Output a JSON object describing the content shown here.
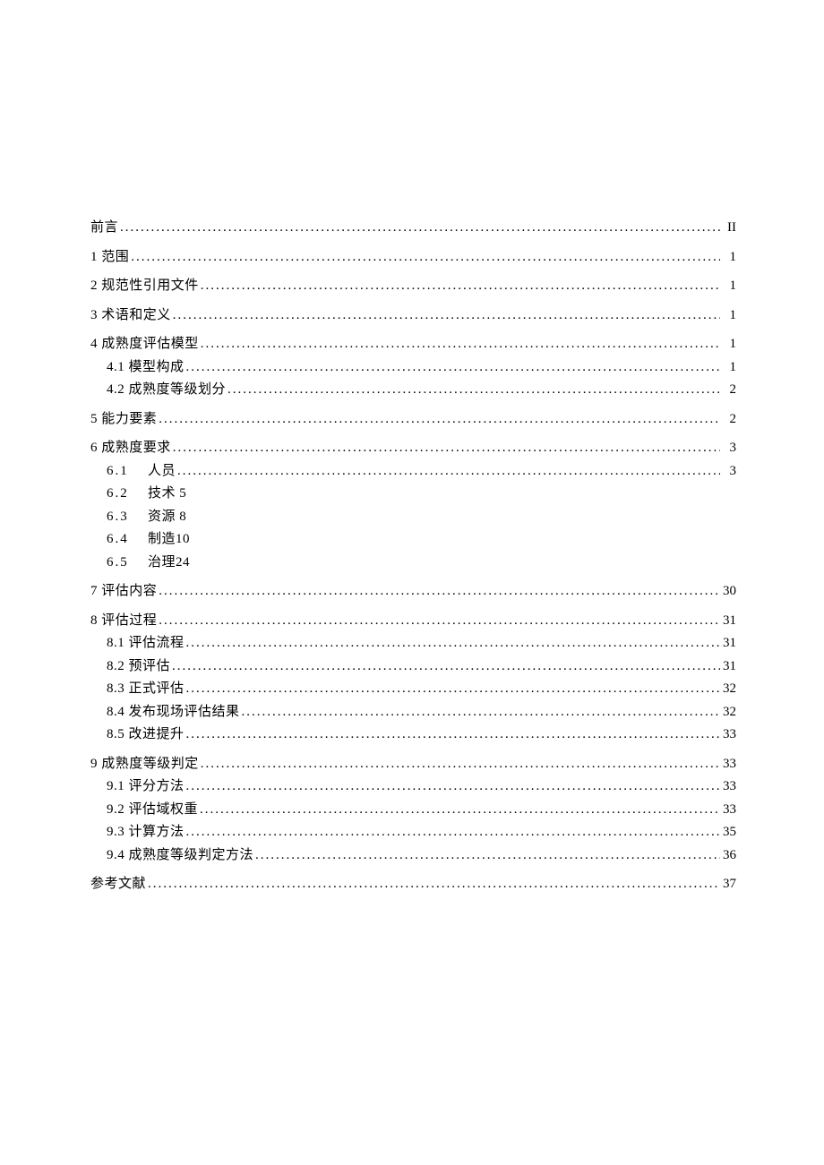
{
  "toc": [
    {
      "level": 0,
      "label": "前言",
      "page": "II",
      "dots": true
    },
    {
      "level": 0,
      "label": "1 范围",
      "page": "1",
      "dots": true
    },
    {
      "level": 0,
      "label": "2 规范性引用文件",
      "page": "1",
      "dots": true
    },
    {
      "level": 0,
      "label": "3 术语和定义",
      "page": "1",
      "dots": true
    },
    {
      "level": 0,
      "label": "4 成熟度评估模型",
      "page": "1",
      "dots": true
    },
    {
      "level": 1,
      "label": "4.1 模型构成",
      "page": "1",
      "dots": true
    },
    {
      "level": 1,
      "label": "4.2 成熟度等级划分",
      "page": "2",
      "dots": true
    },
    {
      "level": 0,
      "label": "5 能力要素",
      "page": "2",
      "dots": true
    },
    {
      "level": 0,
      "label": "6 成熟度要求",
      "page": "3",
      "dots": true
    },
    {
      "level": 1,
      "num": "6.1",
      "text": "人员",
      "page": "3",
      "dots": true
    },
    {
      "level": 1,
      "num": "6.2",
      "text": "技术 5",
      "dots": false
    },
    {
      "level": 1,
      "num": "6.3",
      "text": "资源 8",
      "dots": false
    },
    {
      "level": 1,
      "num": "6.4",
      "text": "制造10",
      "dots": false
    },
    {
      "level": 1,
      "num": "6.5",
      "text": "治理24",
      "dots": false
    },
    {
      "level": 0,
      "label": "7 评估内容",
      "page": "30",
      "dots": true
    },
    {
      "level": 0,
      "label": "8 评估过程",
      "page": "31",
      "dots": true
    },
    {
      "level": 1,
      "label": "8.1 评估流程",
      "page": "31",
      "dots": true
    },
    {
      "level": 1,
      "label": "8.2 预评估",
      "page": "31",
      "dots": true
    },
    {
      "level": 1,
      "label": "8.3 正式评估",
      "page": "32",
      "dots": true
    },
    {
      "level": 1,
      "label": "8.4 发布现场评估结果",
      "page": "32",
      "dots": true
    },
    {
      "level": 1,
      "label": "8.5 改进提升",
      "page": "33",
      "dots": true
    },
    {
      "level": 0,
      "label": "9 成熟度等级判定",
      "page": "33",
      "dots": true
    },
    {
      "level": 1,
      "label": "9.1 评分方法",
      "page": "33",
      "dots": true
    },
    {
      "level": 1,
      "label": "9.2 评估域权重",
      "page": "33",
      "dots": true
    },
    {
      "level": 1,
      "label": "9.3 计算方法",
      "page": "35",
      "dots": true
    },
    {
      "level": 1,
      "label": "9.4 成熟度等级判定方法",
      "page": "36",
      "dots": true
    },
    {
      "level": 0,
      "label": "参考文献",
      "page": "37",
      "dots": true
    }
  ],
  "dotfill": "........................................................................................................................................................"
}
